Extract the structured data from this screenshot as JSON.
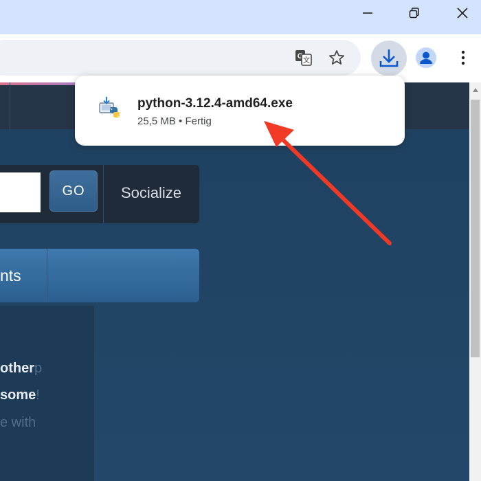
{
  "window": {
    "minimize_glyph": "—",
    "restore_glyph": "❐",
    "close_glyph": "✕"
  },
  "toolbar": {
    "icons": [
      "translate-icon",
      "bookmark-star-icon",
      "download-icon",
      "profile-icon",
      "more-menu-icon"
    ]
  },
  "download_popup": {
    "filename": "python-3.12.4-amd64.exe",
    "meta": "25,5 MB • Fertig"
  },
  "page": {
    "search_button": "GO",
    "socialize_label": "Socialize",
    "menu_label": "nts",
    "lines": [
      {
        "bold": "other",
        "faded": "p"
      },
      {
        "bold": " some",
        "faded": "!"
      },
      {
        "bold": "",
        "faded": "e with"
      }
    ]
  },
  "colors": {
    "annotation_arrow": "#f03a26",
    "download_accent": "#0b57d0",
    "titlebar": "#d3e3fd"
  }
}
